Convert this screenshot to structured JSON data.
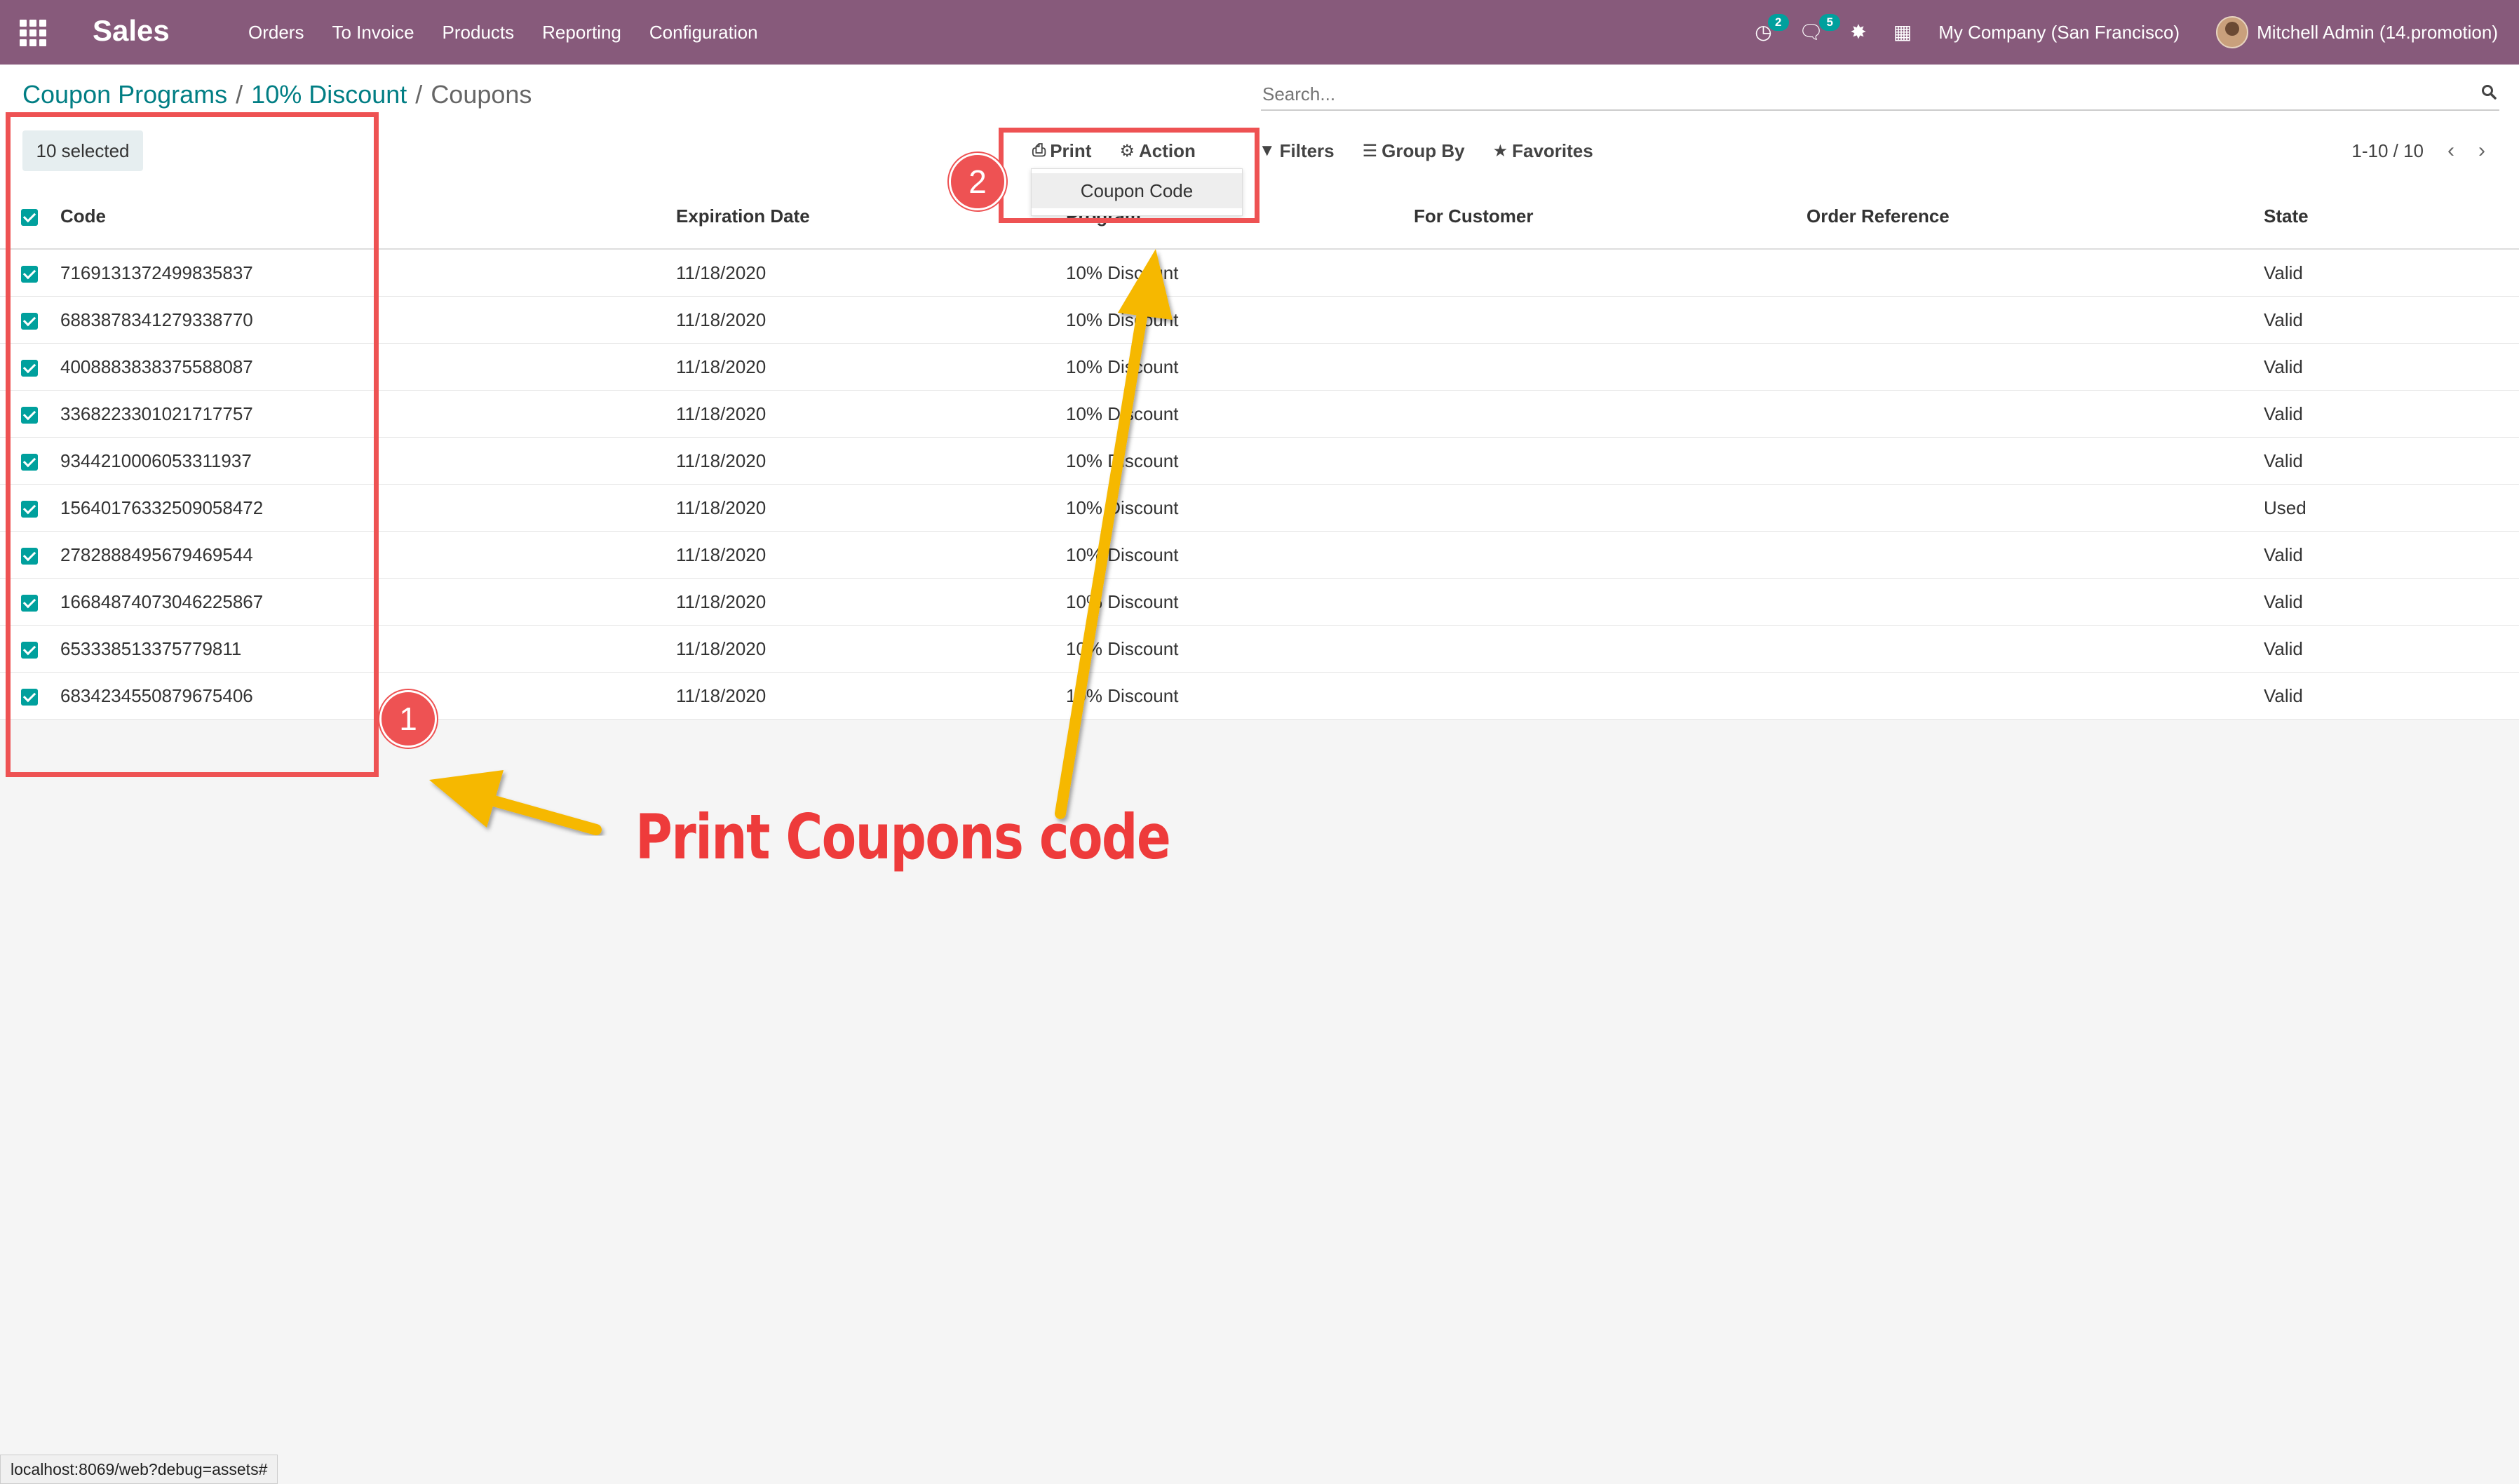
{
  "navbar": {
    "brand": "Sales",
    "menu": [
      "Orders",
      "To Invoice",
      "Products",
      "Reporting",
      "Configuration"
    ],
    "activity_count": "2",
    "messages_count": "5",
    "company": "My Company (San Francisco)",
    "user": "Mitchell Admin (14.promotion)"
  },
  "breadcrumb": {
    "items": [
      "Coupon Programs",
      "10% Discount"
    ],
    "current": "Coupons"
  },
  "search": {
    "placeholder": "Search..."
  },
  "control": {
    "selected": "10 selected",
    "print": "Print",
    "action": "Action",
    "filters": "Filters",
    "group_by": "Group By",
    "favorites": "Favorites",
    "pager": "1-10 / 10"
  },
  "dropdown": {
    "item": "Coupon Code"
  },
  "table": {
    "columns": [
      "Code",
      "Expiration Date",
      "Program",
      "For Customer",
      "Order Reference",
      "State"
    ],
    "rows": [
      [
        "7169131372499835837",
        "11/18/2020",
        "10% Discount",
        "",
        "",
        "Valid"
      ],
      [
        "6883878341279338770",
        "11/18/2020",
        "10% Discount",
        "",
        "",
        "Valid"
      ],
      [
        "4008883838375588087",
        "11/18/2020",
        "10% Discount",
        "",
        "",
        "Valid"
      ],
      [
        "3368223301021717757",
        "11/18/2020",
        "10% Discount",
        "",
        "",
        "Valid"
      ],
      [
        "9344210006053311937",
        "11/18/2020",
        "10% Discount",
        "",
        "",
        "Valid"
      ],
      [
        "15640176332509058472",
        "11/18/2020",
        "10% Discount",
        "",
        "",
        "Used"
      ],
      [
        "2782888495679469544",
        "11/18/2020",
        "10% Discount",
        "",
        "",
        "Valid"
      ],
      [
        "16684874073046225867",
        "11/18/2020",
        "10% Discount",
        "",
        "",
        "Valid"
      ],
      [
        "653338513375779811",
        "11/18/2020",
        "10% Discount",
        "",
        "",
        "Valid"
      ],
      [
        "6834234550879675406",
        "11/18/2020",
        "10% Discount",
        "",
        "",
        "Valid"
      ]
    ]
  },
  "statusbar": "localhost:8069/web?debug=assets#",
  "annotations": {
    "num1": "1",
    "num2": "2",
    "caption": "Print Coupons code",
    "color": "#ee5253",
    "arrow_color": "#f6b800"
  }
}
